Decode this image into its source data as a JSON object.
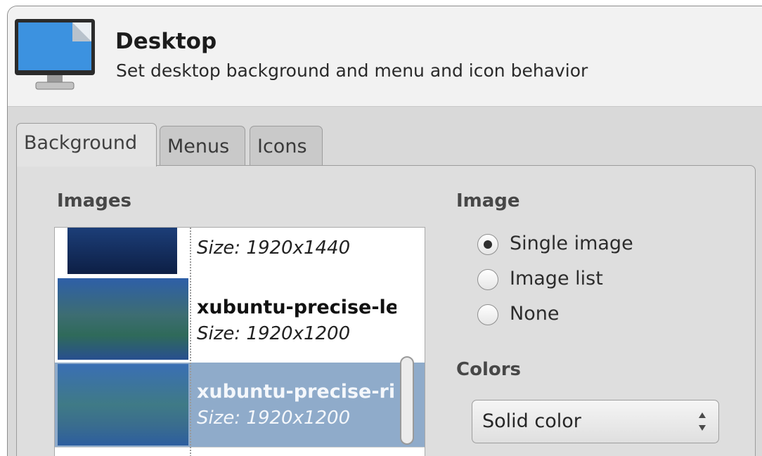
{
  "header": {
    "title": "Desktop",
    "subtitle": "Set desktop background and menu and icon behavior",
    "icon": "monitor-icon"
  },
  "tabs": [
    {
      "label": "Background",
      "active": true
    },
    {
      "label": "Menus",
      "active": false
    },
    {
      "label": "Icons",
      "active": false
    }
  ],
  "images_section": {
    "label": "Images",
    "items": [
      {
        "name": "",
        "size": "Size: 1920x1440",
        "selected": false
      },
      {
        "name": "xubuntu-precise-le",
        "size": "Size: 1920x1200",
        "selected": false
      },
      {
        "name": "xubuntu-precise-ri",
        "size": "Size: 1920x1200",
        "selected": true
      }
    ]
  },
  "image_section": {
    "label": "Image",
    "options": [
      {
        "label": "Single image",
        "checked": true
      },
      {
        "label": "Image list",
        "checked": false
      },
      {
        "label": "None",
        "checked": false
      }
    ]
  },
  "colors_section": {
    "label": "Colors",
    "selected": "Solid color"
  },
  "colors": {
    "selection": "#8fabca",
    "window_bg": "#d9d9d9"
  }
}
